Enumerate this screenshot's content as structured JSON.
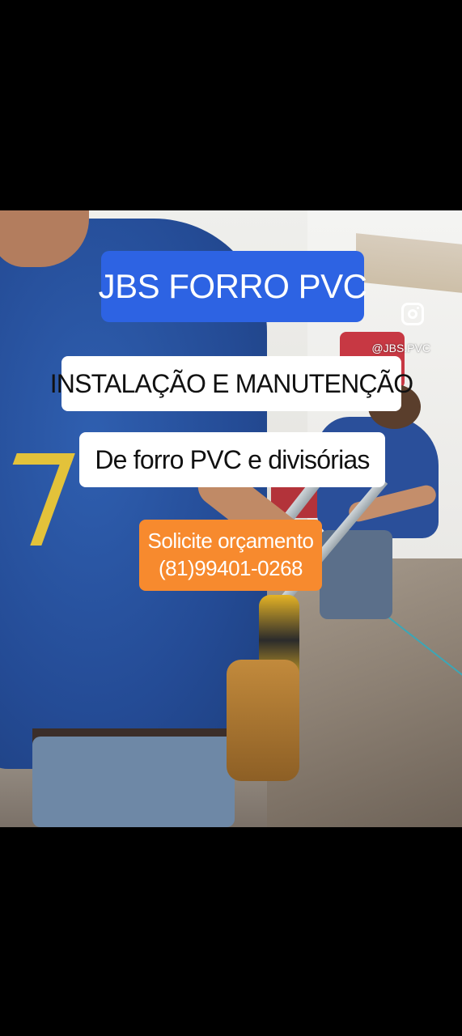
{
  "video": {
    "title_badge": "JBS FORRO PVC",
    "service_line": "INSTALAÇÃO E MANUTENÇÃO",
    "sub_line": "De forro PVC e divisórias",
    "cta_line1": "Solicite orçamento",
    "cta_line2": "(81)99401-0268",
    "instagram_handle": "@JBS.PVC"
  },
  "colors": {
    "title_badge_bg": "#2d63e3",
    "cta_badge_bg": "#f78a2e",
    "text_badge_bg": "#ffffff"
  },
  "icons": {
    "instagram": "instagram-icon"
  }
}
